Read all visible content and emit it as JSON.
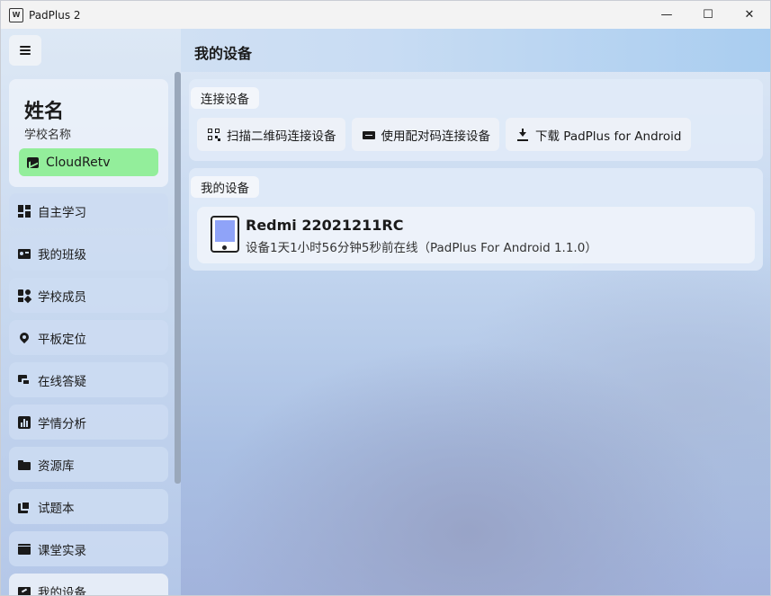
{
  "window": {
    "title": "PadPlus 2",
    "app_icon_text": "W"
  },
  "window_controls": {
    "minimize": "—",
    "maximize": "☐",
    "close": "✕"
  },
  "sidebar": {
    "profile": {
      "name": "姓名",
      "school": "学校名称",
      "tag": "CloudRetv"
    },
    "items": [
      {
        "label": "自主学习",
        "icon": "dashboard-icon"
      },
      {
        "label": "我的班级",
        "icon": "class-card-icon"
      },
      {
        "label": "学校成员",
        "icon": "members-icon"
      },
      {
        "label": "平板定位",
        "icon": "location-icon"
      },
      {
        "label": "在线答疑",
        "icon": "chat-icon"
      },
      {
        "label": "学情分析",
        "icon": "analytics-icon"
      },
      {
        "label": "资源库",
        "icon": "folder-icon"
      },
      {
        "label": "试题本",
        "icon": "book-icon"
      },
      {
        "label": "课堂实录",
        "icon": "video-icon"
      },
      {
        "label": "我的设备",
        "icon": "device-icon",
        "active": true
      }
    ]
  },
  "main": {
    "title": "我的设备",
    "connect": {
      "label": "连接设备",
      "buttons": [
        {
          "label": "扫描二维码连接设备",
          "icon": "qr-code-icon"
        },
        {
          "label": "使用配对码连接设备",
          "icon": "pair-code-icon"
        },
        {
          "label": "下载 PadPlus for Android",
          "icon": "download-icon"
        }
      ]
    },
    "devices": {
      "label": "我的设备",
      "list": [
        {
          "name": "Redmi 22021211RC",
          "status": "设备1天1小时56分钟5秒前在线（PadPlus For Android 1.1.0）"
        }
      ]
    }
  },
  "colors": {
    "tag_green": "#93ee9b",
    "device_screen": "#8fa3f8"
  }
}
